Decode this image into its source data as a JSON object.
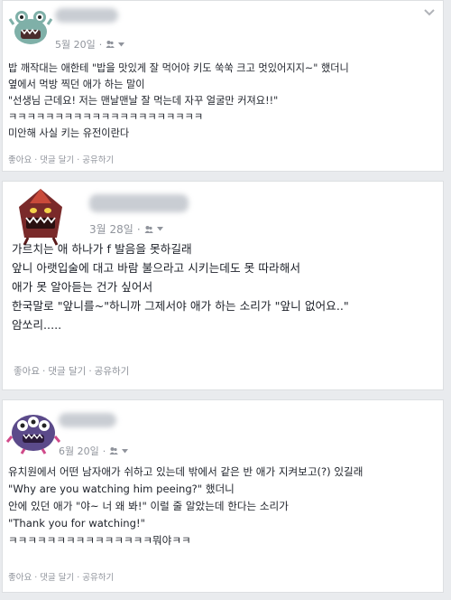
{
  "posts": [
    {
      "date": "5월 20일",
      "lines": [
        "밥 깨작대는 애한테 \"밥을 맛있게 잘 먹어야 키도 쑥쑥 크고 멋있어지지~\" 했더니",
        "옆에서 먹방 찍던 애가 하는 말이",
        "\"선생님 근데요! 저는 맨날맨날 잘 먹는데 자꾸 얼굴만 커져요!!\"",
        "ㅋㅋㅋㅋㅋㅋㅋㅋㅋㅋㅋㅋㅋㅋㅋㅋㅋㅋㅋㅋㅋ",
        "미안해 사실 키는 유전이란다"
      ],
      "actions": {
        "like": "좋아요",
        "comment": "댓글 달기",
        "share": "공유하기"
      }
    },
    {
      "date": "3월 28일",
      "lines": [
        "가르치는 애 하나가 f 발음을 못하길래",
        "앞니 아랫입술에 대고 바람 불으라고 시키는데도 못 따라해서",
        "애가 못 알아듣는 건가 싶어서",
        "한국말로 \"앞니를~\"하니까 그제서야 애가 하는 소리가 \"앞니 없어요..\"",
        "암쏘리....."
      ],
      "actions": {
        "like": "좋아요",
        "comment": "댓글 달기",
        "share": "공유하기"
      }
    },
    {
      "date": "6월 20일",
      "lines": [
        "유치원에서 어떤 남자애가 쉬하고 있는데 밖에서 같은 반 애가 지켜보고(?) 있길래",
        "\"Why are you watching him peeing?\" 했더니",
        "안에 있던 애가 \"야~ 너 왜 봐!\" 이럴 줄 알았는데 한다는 소리가",
        "\"Thank you for watching!\"",
        "ㅋㅋㅋㅋㅋㅋㅋㅋㅋㅋㅋㅋㅋㅋㅋ뭐야ㅋㅋ"
      ],
      "actions": {
        "like": "좋아요",
        "comment": "댓글 달기",
        "share": "공유하기"
      }
    }
  ],
  "icons": {
    "audience": "friends-audience-icon",
    "dropdown": "caret-down-icon",
    "menu": "chevron-down-icon"
  },
  "colors": {
    "page_bg": "#e9ebee",
    "text": "#1d2129",
    "meta": "#90949c"
  }
}
